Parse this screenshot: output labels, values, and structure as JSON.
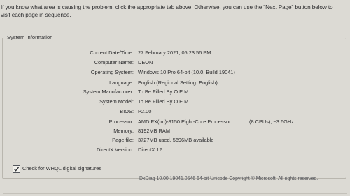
{
  "intro": {
    "line1": "If you know what area is causing the problem, click the appropriate tab above.  Otherwise, you can use the \"Next Page\" button below to",
    "line2": "visit each page in sequence."
  },
  "system_information": {
    "title": "System Information",
    "rows": [
      {
        "label": "Current Date/Time:",
        "value": "27 February 2021, 05:23:56 PM"
      },
      {
        "label": "Computer Name:",
        "value": "DEON"
      },
      {
        "label": "Operating System:",
        "value": "Windows 10 Pro 64-bit (10.0, Build 19041)"
      },
      {
        "label": "Language:",
        "value": "English (Regional Setting: English)"
      },
      {
        "label": "System Manufacturer:",
        "value": "To Be Filled By O.E.M."
      },
      {
        "label": "System Model:",
        "value": "To Be Filled By O.E.M."
      },
      {
        "label": "BIOS:",
        "value": "P2.00"
      },
      {
        "label": "Processor:",
        "value": "AMD FX(tm)-8150 Eight-Core Processor",
        "extra": "(8 CPUs), ~3.6GHz"
      },
      {
        "label": "Memory:",
        "value": "8192MB RAM"
      },
      {
        "label": "Page file:",
        "value": "3727MB used, 5696MB available"
      },
      {
        "label": "DirectX Version:",
        "value": "DirectX 12"
      }
    ]
  },
  "whql_checkbox": {
    "label": "Check for WHQL digital signatures",
    "checked": true
  },
  "footer": {
    "text": "DxDiag 10.00.19041.0546 64-bit Unicode  Copyright © Microsoft. All rights reserved."
  }
}
